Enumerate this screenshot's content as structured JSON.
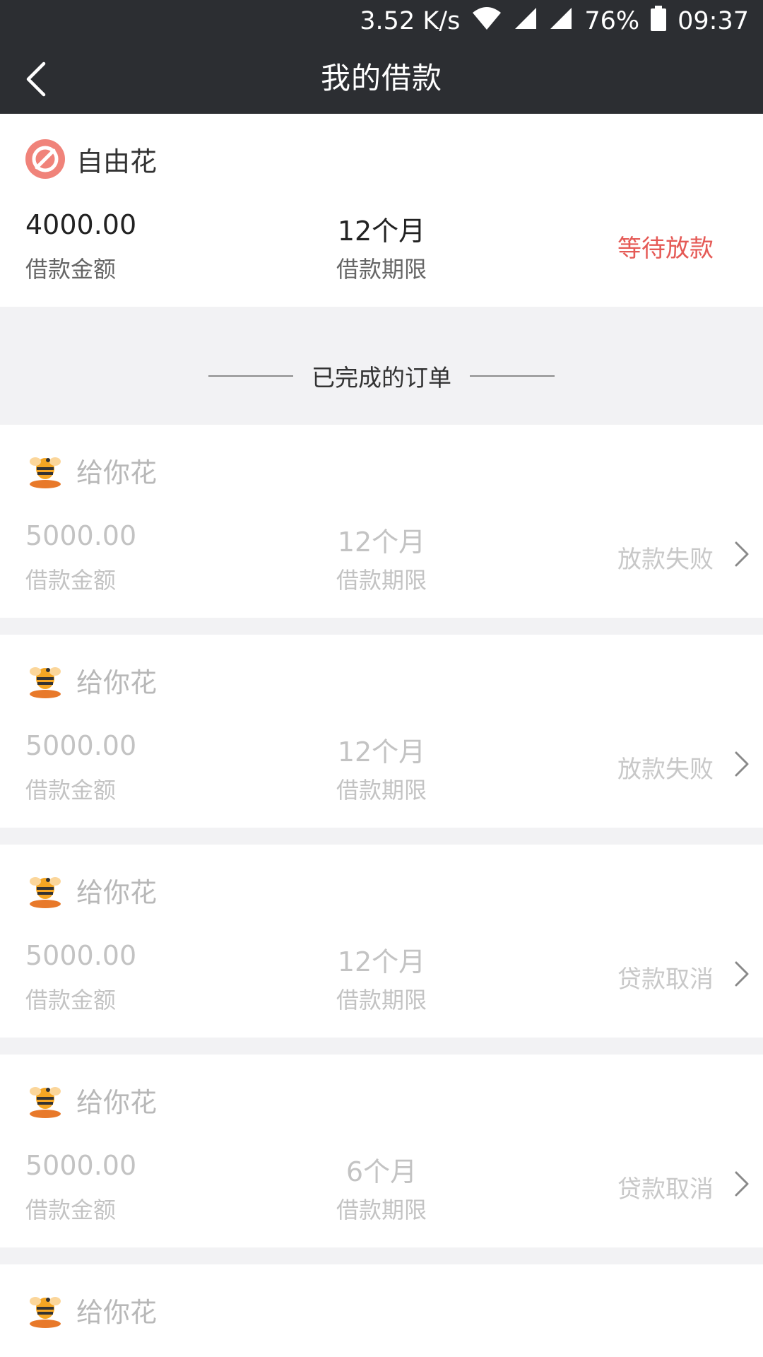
{
  "status_bar": {
    "speed": "3.52 K/s",
    "battery": "76%",
    "time": "09:37",
    "icons": [
      "wifi-icon",
      "signal-icon",
      "signal-icon",
      "battery-icon"
    ]
  },
  "header": {
    "title": "我的借款",
    "back_icon": "chevron-left-icon"
  },
  "active_loan": {
    "brand": "自由花",
    "amount": "4000.00",
    "amount_label": "借款金额",
    "term": "12个月",
    "term_label": "借款期限",
    "status": "等待放款",
    "status_color": "#e55a56"
  },
  "completed_section": {
    "title": "已完成的订单"
  },
  "completed_orders": [
    {
      "brand": "给你花",
      "amount": "5000.00",
      "amount_label": "借款金额",
      "term": "12个月",
      "term_label": "借款期限",
      "status": "放款失败"
    },
    {
      "brand": "给你花",
      "amount": "5000.00",
      "amount_label": "借款金额",
      "term": "12个月",
      "term_label": "借款期限",
      "status": "放款失败"
    },
    {
      "brand": "给你花",
      "amount": "5000.00",
      "amount_label": "借款金额",
      "term": "12个月",
      "term_label": "借款期限",
      "status": "贷款取消"
    },
    {
      "brand": "给你花",
      "amount": "5000.00",
      "amount_label": "借款金额",
      "term": "6个月",
      "term_label": "借款期限",
      "status": "贷款取消"
    },
    {
      "brand": "给你花"
    }
  ]
}
